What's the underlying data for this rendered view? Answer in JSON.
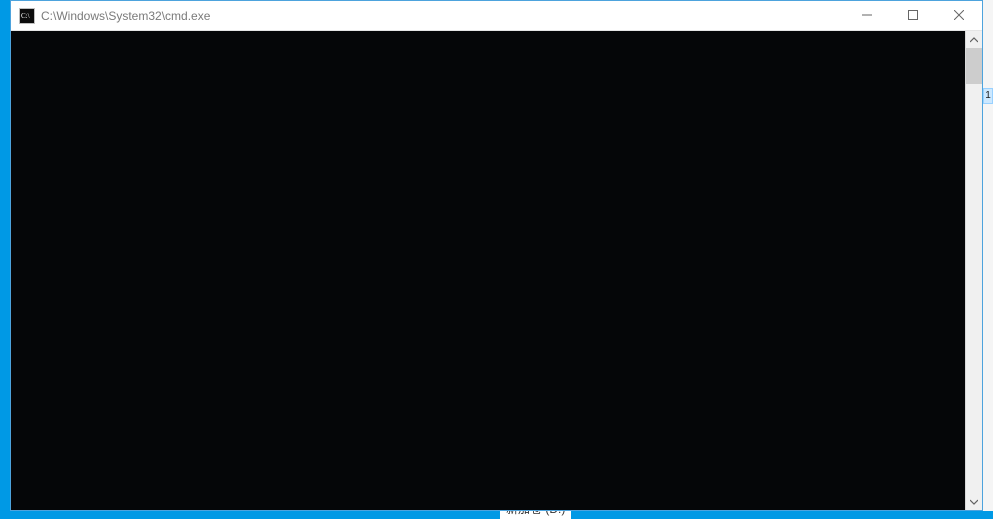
{
  "window": {
    "title": "C:\\Windows\\System32\\cmd.exe"
  },
  "terminal": {
    "content": ""
  },
  "background": {
    "snippet": "新加卷 (D:)",
    "badge": "1"
  }
}
